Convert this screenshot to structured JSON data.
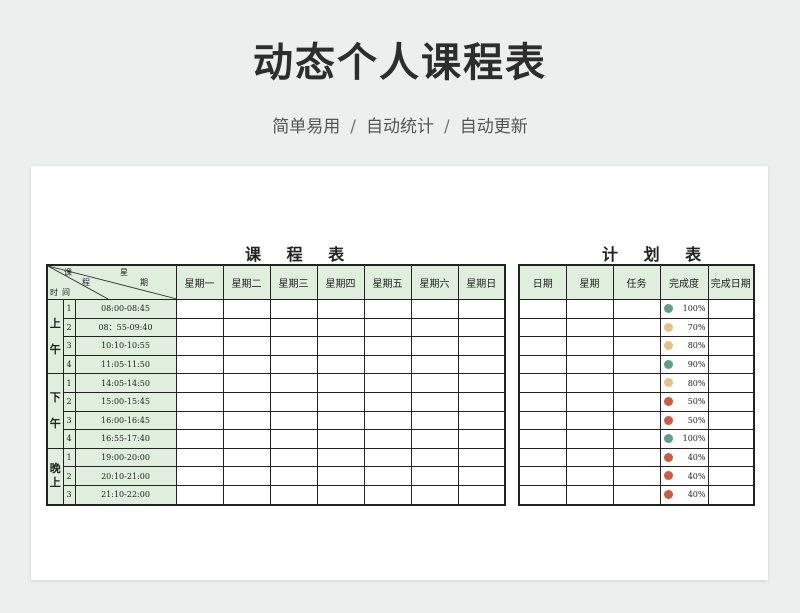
{
  "title": "动态个人课程表",
  "subtitle": [
    "简单易用",
    "自动统计",
    "自动更新"
  ],
  "separator": "/",
  "schedule": {
    "title": "课 程 表",
    "corner": {
      "course": "课",
      "cheng": "程",
      "xing": "星",
      "qi": "期",
      "shi": "时",
      "jian": "间"
    },
    "days": [
      "星期一",
      "星期二",
      "星期三",
      "星期四",
      "星期五",
      "星期六",
      "星期日"
    ],
    "periods": [
      {
        "name": "上午",
        "slots": [
          {
            "n": "1",
            "time": "08:00-08:45"
          },
          {
            "n": "2",
            "time": "08：55-09:40"
          },
          {
            "n": "3",
            "time": "10:10-10:55"
          },
          {
            "n": "4",
            "time": "11:05-11:50"
          }
        ]
      },
      {
        "name": "下午",
        "slots": [
          {
            "n": "1",
            "time": "14:05-14:50"
          },
          {
            "n": "2",
            "time": "15:00-15:45"
          },
          {
            "n": "3",
            "time": "16:00-16:45"
          },
          {
            "n": "4",
            "time": "16:55-17:40"
          }
        ]
      },
      {
        "name": "晚上",
        "slots": [
          {
            "n": "1",
            "time": "19:00-20:00"
          },
          {
            "n": "2",
            "time": "20:10-21:00"
          },
          {
            "n": "3",
            "time": "21:10-22:00"
          }
        ]
      }
    ]
  },
  "plan": {
    "title": "计 划 表",
    "headers": [
      "日期",
      "星期",
      "任务",
      "完成度",
      "完成日期"
    ],
    "rows": [
      {
        "pct": "100%",
        "color": "#5e9e8a"
      },
      {
        "pct": "70%",
        "color": "#e8c082"
      },
      {
        "pct": "80%",
        "color": "#e8c082"
      },
      {
        "pct": "90%",
        "color": "#5e9e8a"
      },
      {
        "pct": "80%",
        "color": "#e8c082"
      },
      {
        "pct": "50%",
        "color": "#cf5b3f"
      },
      {
        "pct": "50%",
        "color": "#cf5b3f"
      },
      {
        "pct": "100%",
        "color": "#5e9e8a"
      },
      {
        "pct": "40%",
        "color": "#cf5b3f"
      },
      {
        "pct": "40%",
        "color": "#cf5b3f"
      },
      {
        "pct": "40%",
        "color": "#cf5b3f"
      }
    ]
  }
}
